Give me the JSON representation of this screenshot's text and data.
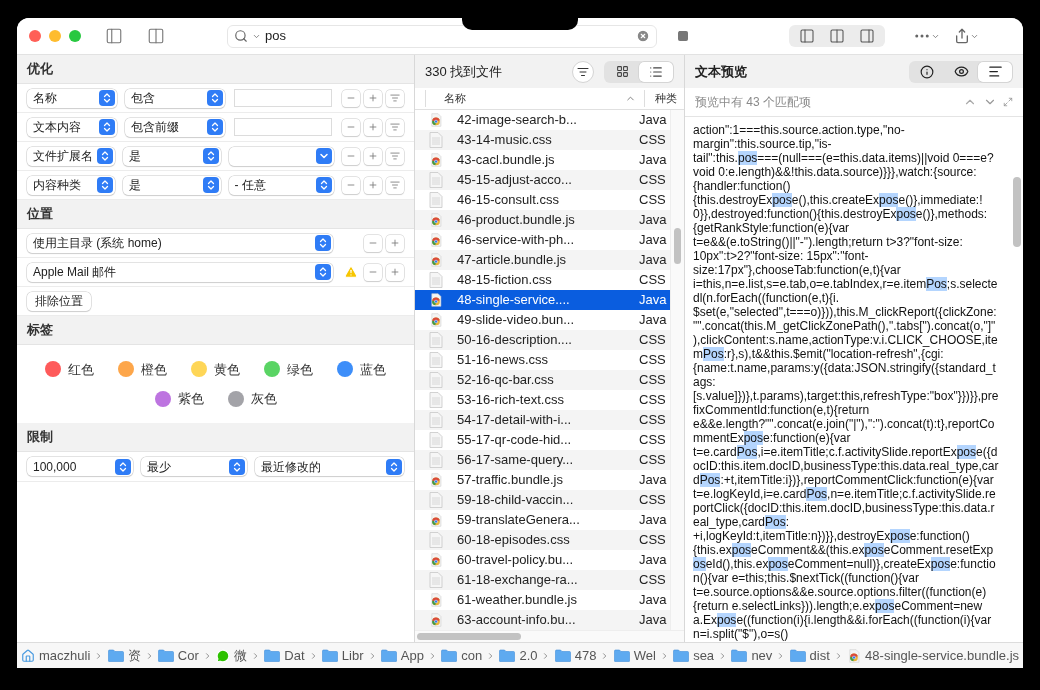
{
  "toolbar": {
    "search": {
      "value": "pos"
    }
  },
  "criteria": {
    "title": "优化",
    "rows": [
      {
        "attribute": "名称",
        "operator": "包含",
        "kind": "text"
      },
      {
        "attribute": "文本内容",
        "operator": "包含前缀",
        "kind": "text"
      },
      {
        "attribute": "文件扩展名",
        "operator": "是",
        "kind": "popup"
      },
      {
        "attribute": "内容种类",
        "operator": "是",
        "kind": "select",
        "value": "- 任意"
      }
    ]
  },
  "location": {
    "title": "位置",
    "rows": [
      {
        "value": "使用主目录 (系统 home)",
        "warning": false
      },
      {
        "value": "Apple Mail 邮件",
        "warning": true
      }
    ],
    "exclude_button": "排除位置"
  },
  "tags": {
    "title": "标签",
    "items": [
      {
        "name": "红色",
        "color": "#fe5a5a"
      },
      {
        "name": "橙色",
        "color": "#fda64a"
      },
      {
        "name": "黄色",
        "color": "#fed657"
      },
      {
        "name": "绿色",
        "color": "#5ad464"
      },
      {
        "name": "蓝色",
        "color": "#3d8ef9"
      },
      {
        "name": "紫色",
        "color": "#bd74e0"
      },
      {
        "name": "灰色",
        "color": "#a3a3a8"
      }
    ]
  },
  "limits": {
    "title": "限制",
    "selects": [
      "100,000",
      "最少",
      "最近修改的"
    ]
  },
  "results": {
    "title": "330 找到文件",
    "view_modes": [
      {
        "kind": "grid",
        "selected": false
      },
      {
        "kind": "list",
        "selected": true
      }
    ],
    "columns": [
      "名称",
      "种类"
    ],
    "rows": [
      {
        "name": "42-image-search-b...",
        "type": "Java",
        "kind": "chrome",
        "selected": false
      },
      {
        "name": "43-14-music.css",
        "type": "CSS",
        "kind": "document",
        "selected": false
      },
      {
        "name": "43-cacl.bundle.js",
        "type": "Java",
        "kind": "chrome",
        "selected": false
      },
      {
        "name": "45-15-adjust-acco...",
        "type": "CSS",
        "kind": "document",
        "selected": false
      },
      {
        "name": "46-15-consult.css",
        "type": "CSS",
        "kind": "document",
        "selected": false
      },
      {
        "name": "46-product.bundle.js",
        "type": "Java",
        "kind": "chrome",
        "selected": false
      },
      {
        "name": "46-service-with-ph...",
        "type": "Java",
        "kind": "chrome",
        "selected": false
      },
      {
        "name": "47-article.bundle.js",
        "type": "Java",
        "kind": "chrome",
        "selected": false
      },
      {
        "name": "48-15-fiction.css",
        "type": "CSS",
        "kind": "document",
        "selected": false
      },
      {
        "name": "48-single-service....",
        "type": "Java",
        "kind": "chrome",
        "selected": true
      },
      {
        "name": "49-slide-video.bun...",
        "type": "Java",
        "kind": "chrome",
        "selected": false
      },
      {
        "name": "50-16-description....",
        "type": "CSS",
        "kind": "document",
        "selected": false
      },
      {
        "name": "51-16-news.css",
        "type": "CSS",
        "kind": "document",
        "selected": false
      },
      {
        "name": "52-16-qc-bar.css",
        "type": "CSS",
        "kind": "document",
        "selected": false
      },
      {
        "name": "53-16-rich-text.css",
        "type": "CSS",
        "kind": "document",
        "selected": false
      },
      {
        "name": "54-17-detail-with-i...",
        "type": "CSS",
        "kind": "document",
        "selected": false
      },
      {
        "name": "55-17-qr-code-hid...",
        "type": "CSS",
        "kind": "document",
        "selected": false
      },
      {
        "name": "56-17-same-query...",
        "type": "CSS",
        "kind": "document",
        "selected": false
      },
      {
        "name": "57-traffic.bundle.js",
        "type": "Java",
        "kind": "chrome",
        "selected": false
      },
      {
        "name": "59-18-child-vaccin...",
        "type": "CSS",
        "kind": "document",
        "selected": false
      },
      {
        "name": "59-translateGenera...",
        "type": "Java",
        "kind": "chrome",
        "selected": false
      },
      {
        "name": "60-18-episodes.css",
        "type": "CSS",
        "kind": "document",
        "selected": false
      },
      {
        "name": "60-travel-policy.bu...",
        "type": "Java",
        "kind": "chrome",
        "selected": false
      },
      {
        "name": "61-18-exchange-ra...",
        "type": "CSS",
        "kind": "document",
        "selected": false
      },
      {
        "name": "61-weather.bundle.js",
        "type": "Java",
        "kind": "chrome",
        "selected": false
      },
      {
        "name": "63-account-info.bu...",
        "type": "Java",
        "kind": "chrome",
        "selected": false
      }
    ]
  },
  "preview": {
    "title": "文本预览",
    "modes": [
      {
        "kind": "info",
        "selected": false
      },
      {
        "kind": "eye",
        "selected": false
      },
      {
        "kind": "text",
        "selected": true
      }
    ],
    "match_count": "预览中有 43 个匹配项",
    "lines": [
      [
        {
          "text": "action\":1===this.source.action.type,\"no-",
          "match": false
        }
      ],
      [
        {
          "text": "margin\":this.source.tip,\"is-",
          "match": false
        }
      ],
      [
        {
          "text": "tail\":this.",
          "match": false
        },
        {
          "text": "pos",
          "match": true
        },
        {
          "text": "===(null===(e=this.data.items)||void 0===e?",
          "match": false
        }
      ],
      [
        {
          "text": "void 0:e.length)&&!this.data.source)}}},watch:{source:",
          "match": false
        }
      ],
      [
        {
          "text": "{handler:function()",
          "match": false
        }
      ],
      [
        {
          "text": "{this.destroyEx",
          "match": false
        },
        {
          "text": "pos",
          "match": true
        },
        {
          "text": "e(),this.createEx",
          "match": false
        },
        {
          "text": "pos",
          "match": true
        },
        {
          "text": "e()},immediate:!",
          "match": false
        }
      ],
      [
        {
          "text": "0}},destroyed:function(){this.destroyEx",
          "match": false
        },
        {
          "text": "pos",
          "match": true
        },
        {
          "text": "e()},methods:",
          "match": false
        }
      ],
      [
        {
          "text": "{getRankStyle:function(e){var",
          "match": false
        }
      ],
      [
        {
          "text": "t=e&&(e.toString()||\"-\").length;return t>3?\"font-size:",
          "match": false
        }
      ],
      [
        {
          "text": "10px\":t>2?\"font-size: 15px\":\"font-",
          "match": false
        }
      ],
      [
        {
          "text": "size:17px\"},chooseTab:function(e,t){var",
          "match": false
        }
      ],
      [
        {
          "text": "i=this,n=e.list,s=e.tab,o=e.tabIndex,r=e.item",
          "match": false
        },
        {
          "text": "Pos",
          "match": true
        },
        {
          "text": ";s.selecte",
          "match": false
        }
      ],
      [
        {
          "text": "dl(n.forEach((function(e,t){i.",
          "match": false
        }
      ],
      [
        {
          "text": "$set(e,\"selected\",t===o)})),this.M_clickReport({clickZone:",
          "match": false
        }
      ],
      [
        {
          "text": "\"\".concat(this.M_getClickZonePath(),\".tabs[\").concat(o,\"]\"",
          "match": false
        }
      ],
      [
        {
          "text": "),clickContent:s.name,actionType:v.i.CLICK_CHOOSE,ite",
          "match": false
        }
      ],
      [
        {
          "text": "m",
          "match": false
        },
        {
          "text": "Pos",
          "match": true
        },
        {
          "text": ":r},s),t&&this.$emit(\"location-refresh\",{cgi:",
          "match": false
        }
      ],
      [
        {
          "text": "{name:t.name,params:y({data:JSON.stringify({standard_t",
          "match": false
        }
      ],
      [
        {
          "text": "ags:",
          "match": false
        }
      ],
      [
        {
          "text": "[s.value]})},t.params),target:this,refreshType:\"box\"}})}},pre",
          "match": false
        }
      ],
      [
        {
          "text": "fixCommentId:function(e,t){return",
          "match": false
        }
      ],
      [
        {
          "text": "e&&e.length?\"\".concat(e.join(\"|\"),\":\").concat(t):t},reportCo",
          "match": false
        }
      ],
      [
        {
          "text": "mmentEx",
          "match": false
        },
        {
          "text": "pos",
          "match": true
        },
        {
          "text": "e:function(e){var",
          "match": false
        }
      ],
      [
        {
          "text": "t=e.card",
          "match": false
        },
        {
          "text": "Pos",
          "match": true
        },
        {
          "text": ",i=e.itemTitle;c.f.activitySlide.reportEx",
          "match": false
        },
        {
          "text": "pos",
          "match": true
        },
        {
          "text": "e({d",
          "match": false
        }
      ],
      [
        {
          "text": "ocID:this.item.docID,businessType:this.data.real_type,car",
          "match": false
        }
      ],
      [
        {
          "text": "d",
          "match": false
        },
        {
          "text": "Pos",
          "match": true
        },
        {
          "text": ":+t,itemTitle:i})},reportCommentClick:function(e){var",
          "match": false
        }
      ],
      [
        {
          "text": "t=e.logKeyId,i=e.card",
          "match": false
        },
        {
          "text": "Pos",
          "match": true
        },
        {
          "text": ",n=e.itemTitle;c.f.activitySlide.re",
          "match": false
        }
      ],
      [
        {
          "text": "portClick({docID:this.item.docID,businessType:this.data.r",
          "match": false
        }
      ],
      [
        {
          "text": "eal_type,card",
          "match": false
        },
        {
          "text": "Pos",
          "match": true
        },
        {
          "text": ":",
          "match": false
        }
      ],
      [
        {
          "text": "+i,logKeyId:t,itemTitle:n})}},destroyEx",
          "match": false
        },
        {
          "text": "pos",
          "match": true
        },
        {
          "text": "e:function()",
          "match": false
        }
      ],
      [
        {
          "text": "{this.ex",
          "match": false
        },
        {
          "text": "pos",
          "match": true
        },
        {
          "text": "eComment&&(this.ex",
          "match": false
        },
        {
          "text": "pos",
          "match": true
        },
        {
          "text": "eComment.resetExp",
          "match": false
        }
      ],
      [
        {
          "text": "os",
          "match": true
        },
        {
          "text": "eId(),this.ex",
          "match": false
        },
        {
          "text": "pos",
          "match": true
        },
        {
          "text": "eComment=null)},createEx",
          "match": false
        },
        {
          "text": "pos",
          "match": true
        },
        {
          "text": "e:functio",
          "match": false
        }
      ],
      [
        {
          "text": "n(){var e=this;this.$nextTick((function(){var",
          "match": false
        }
      ],
      [
        {
          "text": "t=e.source.options&&e.source.options.filter((function(e)",
          "match": false
        }
      ],
      [
        {
          "text": "{return e.selectLinks})).length;e.ex",
          "match": false
        },
        {
          "text": "pos",
          "match": true
        },
        {
          "text": "eComment=new",
          "match": false
        }
      ],
      [
        {
          "text": "a.Ex",
          "match": false
        },
        {
          "text": "pos",
          "match": true
        },
        {
          "text": "e((function(i){i.length&&i.forEach((function(i){var",
          "match": false
        }
      ],
      [
        {
          "text": "n=i.split(\"$\"),o=s()",
          "match": false
        }
      ]
    ]
  },
  "path_bar": [
    {
      "label": "maczhuli",
      "kind": "home"
    },
    {
      "label": "资",
      "kind": "folder"
    },
    {
      "label": "Cor",
      "kind": "folder"
    },
    {
      "label": "微",
      "kind": "chat"
    },
    {
      "label": "Dat",
      "kind": "folder"
    },
    {
      "label": "Libr",
      "kind": "folder"
    },
    {
      "label": "App",
      "kind": "folder"
    },
    {
      "label": "con",
      "kind": "folder"
    },
    {
      "label": "2.0",
      "kind": "folder"
    },
    {
      "label": "478",
      "kind": "folder"
    },
    {
      "label": "Wel",
      "kind": "folder"
    },
    {
      "label": "sea",
      "kind": "folder"
    },
    {
      "label": "nev",
      "kind": "folder"
    },
    {
      "label": "dist",
      "kind": "folder"
    },
    {
      "label": "48-single-service.bundle.js",
      "kind": "chrome"
    }
  ]
}
